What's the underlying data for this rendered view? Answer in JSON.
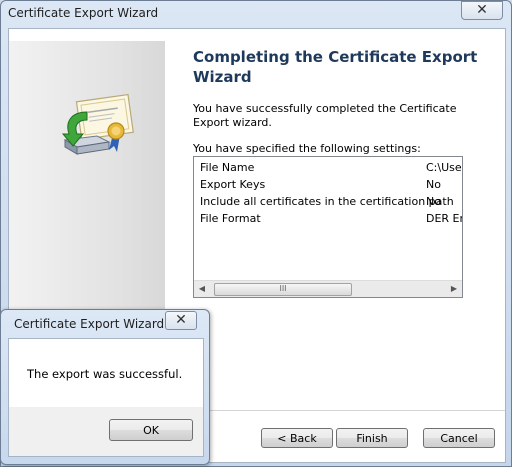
{
  "wizard": {
    "title": "Certificate Export Wizard",
    "close_glyph": "✕",
    "heading": "Completing the Certificate Export Wizard",
    "description": "You have successfully completed the Certificate Export wizard.",
    "settings_label": "You have specified the following settings:",
    "settings": [
      {
        "key": "File Name",
        "value": "C:\\User"
      },
      {
        "key": "Export Keys",
        "value": "No"
      },
      {
        "key": "Include all certificates in the certification path",
        "value": "No"
      },
      {
        "key": "File Format",
        "value": "DER En"
      }
    ],
    "scroll_left": "◀",
    "scroll_right": "▶",
    "scroll_grip": "III",
    "buttons": {
      "back": "< Back",
      "finish": "Finish",
      "cancel": "Cancel"
    }
  },
  "dialog": {
    "title": "Certificate Export Wizard",
    "close_glyph": "✕",
    "message": "The export was successful.",
    "ok": "OK"
  },
  "icons": [
    "certificate-export-icon",
    "close-icon"
  ]
}
